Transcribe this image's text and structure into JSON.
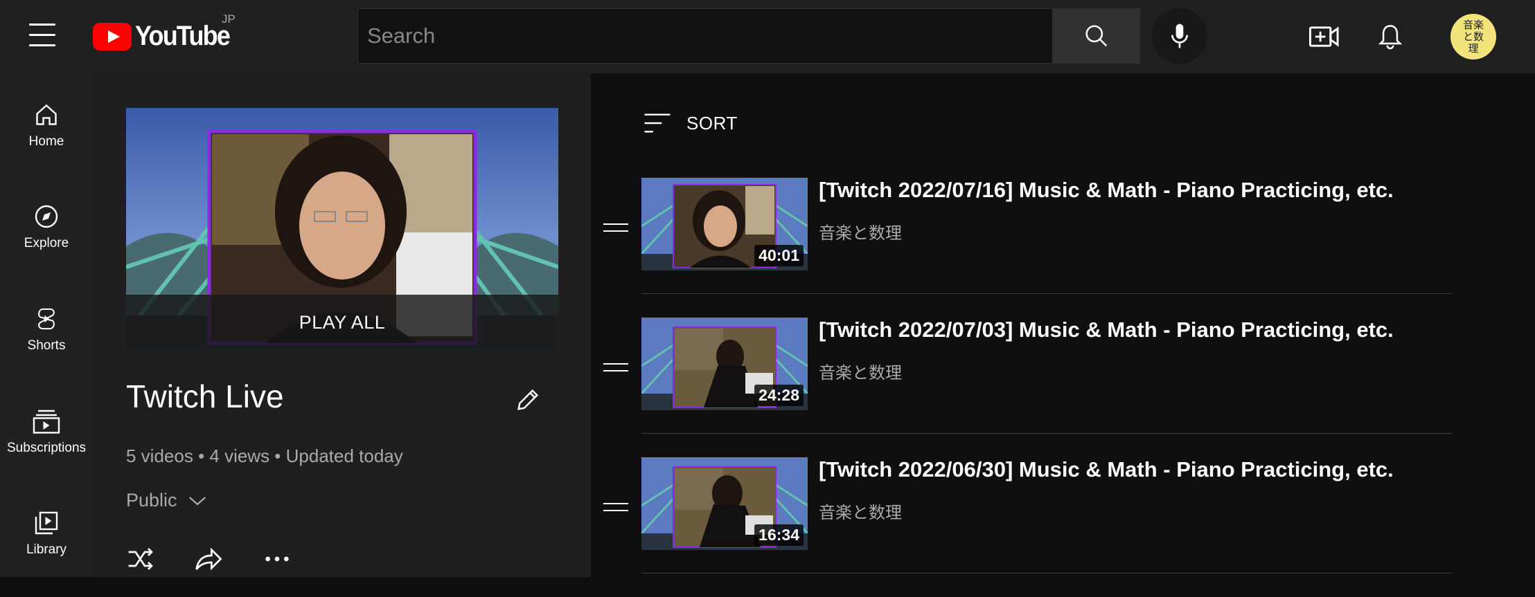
{
  "header": {
    "logo_text": "YouTube",
    "region": "JP",
    "search_placeholder": "Search",
    "avatar_text": "音楽と数理"
  },
  "sidebar": {
    "items": [
      {
        "label": "Home",
        "icon": "home-icon"
      },
      {
        "label": "Explore",
        "icon": "compass-icon"
      },
      {
        "label": "Shorts",
        "icon": "shorts-icon"
      },
      {
        "label": "Subscriptions",
        "icon": "subscriptions-icon"
      },
      {
        "label": "Library",
        "icon": "library-icon"
      }
    ]
  },
  "playlist": {
    "play_all_label": "PLAY ALL",
    "title": "Twitch Live",
    "meta": "5 videos • 4 views • Updated today",
    "privacy": "Public"
  },
  "list": {
    "sort_label": "SORT",
    "videos": [
      {
        "title": "[Twitch 2022/07/16] Music & Math - Piano Practicing, etc.",
        "channel": "音楽と数理",
        "duration": "40:01"
      },
      {
        "title": "[Twitch 2022/07/03] Music & Math - Piano Practicing, etc.",
        "channel": "音楽と数理",
        "duration": "24:28"
      },
      {
        "title": "[Twitch 2022/06/30] Music & Math - Piano Practicing, etc.",
        "channel": "音楽と数理",
        "duration": "16:34"
      }
    ]
  },
  "colors": {
    "brand_red": "#ff0000",
    "header_bg": "#202020",
    "frame_purple": "#8a2be2"
  }
}
